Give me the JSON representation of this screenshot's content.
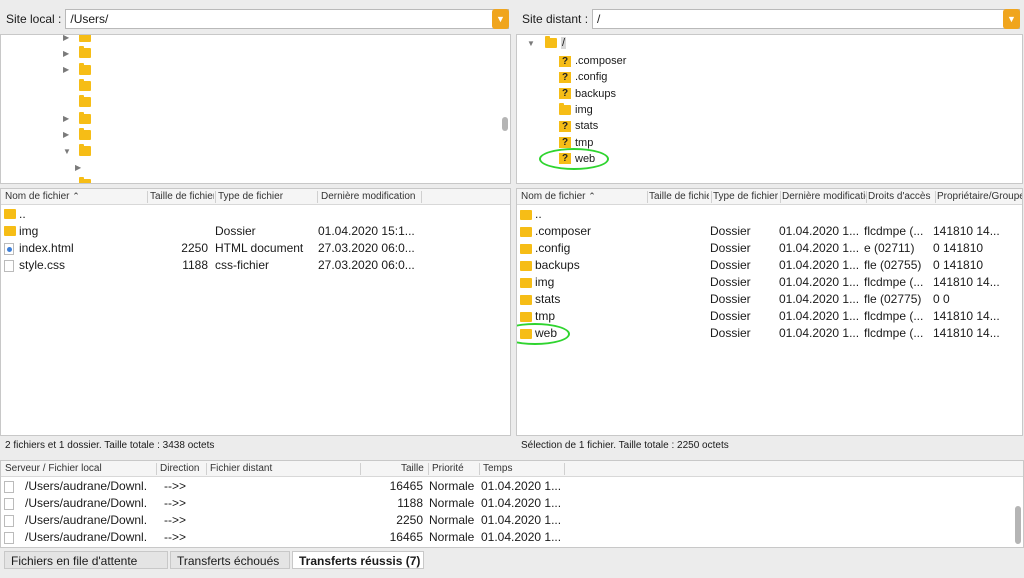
{
  "local": {
    "label": "Site local :",
    "path": "/Users/",
    "tree_arrows": [
      "▶",
      "▶",
      "▶",
      "",
      "",
      "▶",
      "▶",
      "▼",
      "▶",
      ""
    ],
    "headers": {
      "name": "Nom de fichier",
      "size": "Taille de fichier",
      "type": "Type de fichier",
      "modified": "Dernière modification"
    },
    "files": [
      {
        "name": "..",
        "size": "",
        "type": "",
        "modified": "",
        "icon": "folder"
      },
      {
        "name": "img",
        "size": "",
        "type": "Dossier",
        "modified": "01.04.2020 15:1...",
        "icon": "folder"
      },
      {
        "name": "index.html",
        "size": "2250",
        "type": "HTML document",
        "modified": "27.03.2020 06:0...",
        "icon": "html"
      },
      {
        "name": "style.css",
        "size": "1188",
        "type": "css-fichier",
        "modified": "27.03.2020 06:0...",
        "icon": "file"
      }
    ],
    "status": "2 fichiers et 1 dossier. Taille totale : 3438 octets"
  },
  "remote": {
    "label": "Site distant :",
    "path": "/",
    "tree_root": "/",
    "tree_items": [
      ".composer",
      ".config",
      "backups",
      "img",
      "stats",
      "tmp",
      "web"
    ],
    "headers": {
      "name": "Nom de fichier",
      "size": "Taille de fichier",
      "type": "Type de fichier",
      "modified": "Dernière modification",
      "perms": "Droits d'accès",
      "owner": "Propriétaire/Groupe"
    },
    "files": [
      {
        "name": "..",
        "type": "",
        "modified": "",
        "perms": "",
        "owner": ""
      },
      {
        "name": ".composer",
        "type": "Dossier",
        "modified": "01.04.2020 1...",
        "perms": "flcdmpe (...",
        "owner": "141810 14..."
      },
      {
        "name": ".config",
        "type": "Dossier",
        "modified": "01.04.2020 1...",
        "perms": "e (02711)",
        "owner": "0 141810"
      },
      {
        "name": "backups",
        "type": "Dossier",
        "modified": "01.04.2020 1...",
        "perms": "fle (02755)",
        "owner": "0 141810"
      },
      {
        "name": "img",
        "type": "Dossier",
        "modified": "01.04.2020 1...",
        "perms": "flcdmpe (...",
        "owner": "141810 14..."
      },
      {
        "name": "stats",
        "type": "Dossier",
        "modified": "01.04.2020 1...",
        "perms": "fle (02775)",
        "owner": "0 0"
      },
      {
        "name": "tmp",
        "type": "Dossier",
        "modified": "01.04.2020 1...",
        "perms": "flcdmpe (...",
        "owner": "141810 14..."
      },
      {
        "name": "web",
        "type": "Dossier",
        "modified": "01.04.2020 1...",
        "perms": "flcdmpe (...",
        "owner": "141810 14..."
      }
    ],
    "status": "Sélection de 1 fichier. Taille totale : 2250 octets"
  },
  "queue": {
    "headers": {
      "server": "Serveur / Fichier local",
      "direction": "Direction",
      "remote": "Fichier distant",
      "size": "Taille",
      "priority": "Priorité",
      "time": "Temps"
    },
    "rows": [
      {
        "local": "/Users/audrane/Downl.",
        "direction": "-->>",
        "size": "16465",
        "priority": "Normale",
        "time": "01.04.2020 1..."
      },
      {
        "local": "/Users/audrane/Downl.",
        "direction": "-->>",
        "size": "1188",
        "priority": "Normale",
        "time": "01.04.2020 1..."
      },
      {
        "local": "/Users/audrane/Downl.",
        "direction": "-->>",
        "size": "2250",
        "priority": "Normale",
        "time": "01.04.2020 1..."
      },
      {
        "local": "/Users/audrane/Downl.",
        "direction": "-->>",
        "size": "16465",
        "priority": "Normale",
        "time": "01.04.2020 1..."
      }
    ],
    "tabs": [
      "Fichiers en file d'attente",
      "Transferts échoués",
      "Transferts réussis (7)"
    ]
  },
  "colors": {
    "accent": "#f0a51d",
    "folder": "#f6bd16",
    "highlight_circle": "#2fd42f"
  }
}
